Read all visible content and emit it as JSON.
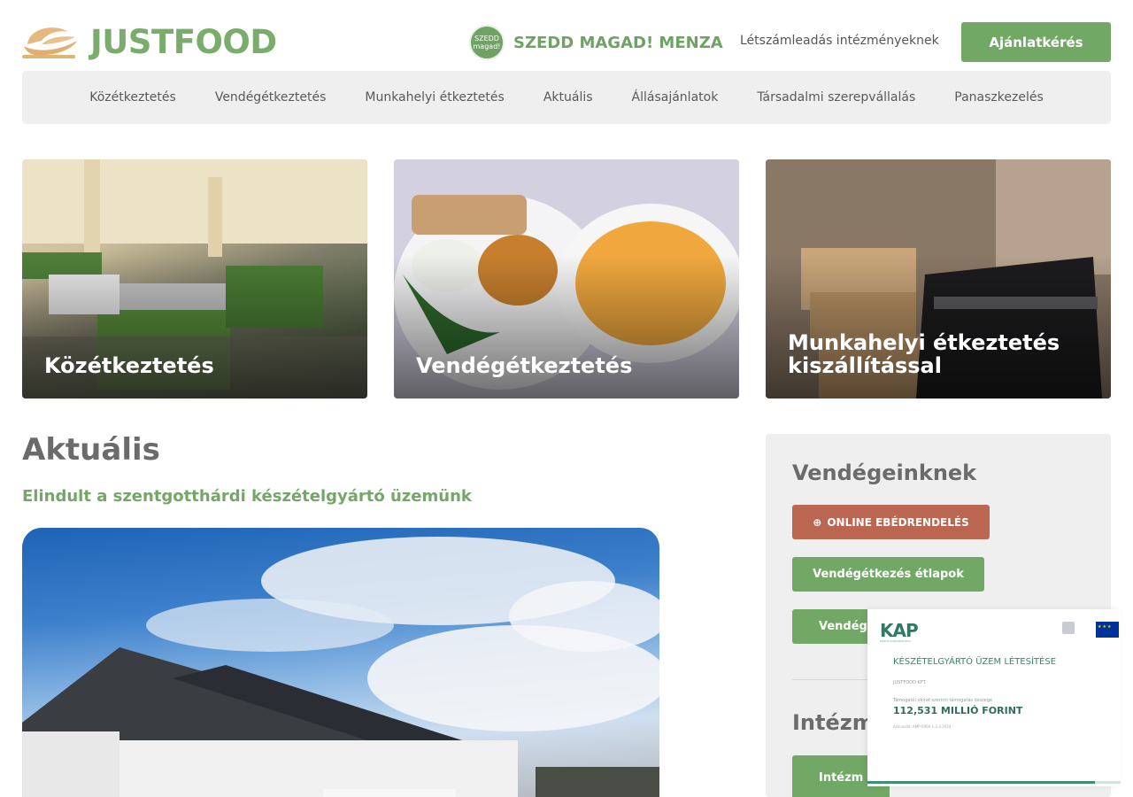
{
  "header": {
    "logo_text": "JUSTFOOD",
    "menza_badge": "SZEDD magad!",
    "menza_text": "SZEDD MAGAD! MENZA",
    "letszam_link": "Létszámleadás intézményeknek",
    "offer_button": "Ajánlatkérés"
  },
  "nav": {
    "items": [
      "Közétkeztetés",
      "Vendégétkeztetés",
      "Munkahelyi étkeztetés",
      "Aktuális",
      "Állásajánlatok",
      "Társadalmi szerepvállalás",
      "Panaszkezelés"
    ]
  },
  "cards": [
    {
      "title": "Közétkeztetés"
    },
    {
      "title": "Vendégétkeztetés"
    },
    {
      "title": "Munkahelyi étkeztetés kiszállítással"
    }
  ],
  "news": {
    "heading": "Aktuális",
    "article_title": "Elindult a szentgotthárdi készételgyártó üzemünk"
  },
  "sidebar": {
    "heading": "Vendégeinknek",
    "order_button": "ONLINE EBÉDRENDELÉS",
    "menu_button": "Vendégétkezés étlapok",
    "third_button": "Vendég",
    "heading2": "Intézm",
    "institution_button": "Intézm"
  },
  "kap_popup": {
    "logo": "KAP",
    "logo_sub": "KÖZÖS AGRÁRPOLITIKA",
    "title": "KÉSZÉTELGYÁRTÓ ÜZEM LÉTESÍTÉSE",
    "company": "JUSTFOOD KFT.",
    "support_label": "Támogatói okirat szerinti támogatás összege",
    "amount": "112,531 MILLIÓ FORINT",
    "project_id": "Azonosító: AMP-0004-1.2.3-2024",
    "progress": 0.9,
    "colors": {
      "accent": "#2f8a69"
    }
  },
  "colors": {
    "brand_green": "#72a866",
    "order_red": "#bb6650",
    "nav_bg": "#efefef"
  }
}
